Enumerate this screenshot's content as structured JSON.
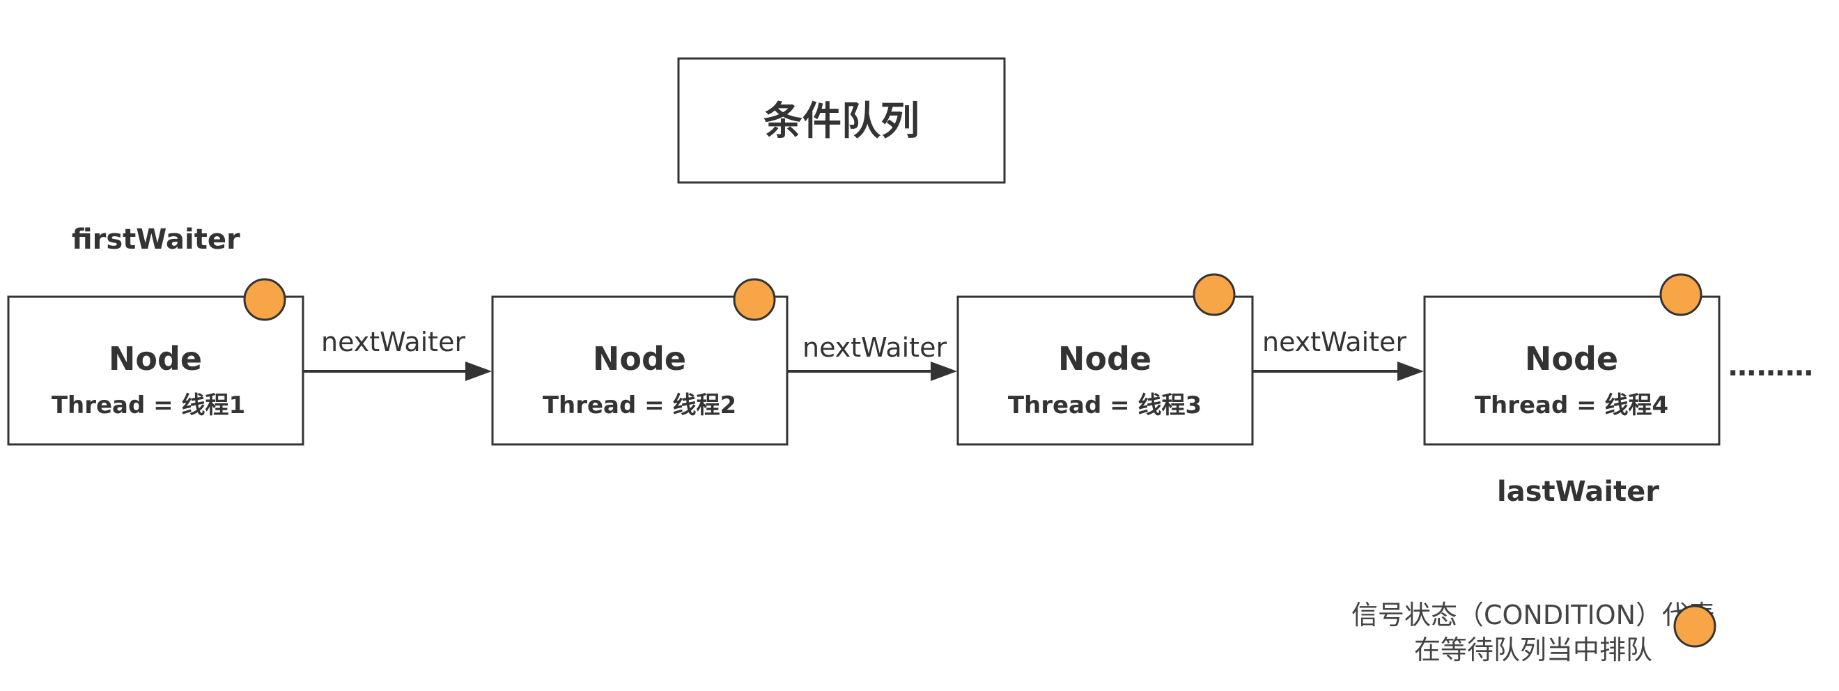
{
  "diagram": {
    "title": "条件队列",
    "pointers": {
      "first": "firstWaiter",
      "last": "lastWaiter"
    },
    "nodes": [
      {
        "label": "Node",
        "thread": "Thread = 线程1",
        "state_icon": "orange-circle"
      },
      {
        "label": "Node",
        "thread": "Thread = 线程2",
        "state_icon": "orange-circle"
      },
      {
        "label": "Node",
        "thread": "Thread = 线程3",
        "state_icon": "orange-circle"
      },
      {
        "label": "Node",
        "thread": "Thread = 线程4",
        "state_icon": "orange-circle"
      }
    ],
    "edges": [
      {
        "label": "nextWaiter"
      },
      {
        "label": "nextWaiter"
      },
      {
        "label": "nextWaiter"
      }
    ],
    "ellipsis": "………",
    "legend": {
      "line1": "信号状态（CONDITION）代表",
      "line2": "在等待队列当中排队",
      "icon": "orange-circle"
    },
    "colors": {
      "state_circle": "#f7a546",
      "stroke": "#333333",
      "text": "#333333"
    }
  }
}
